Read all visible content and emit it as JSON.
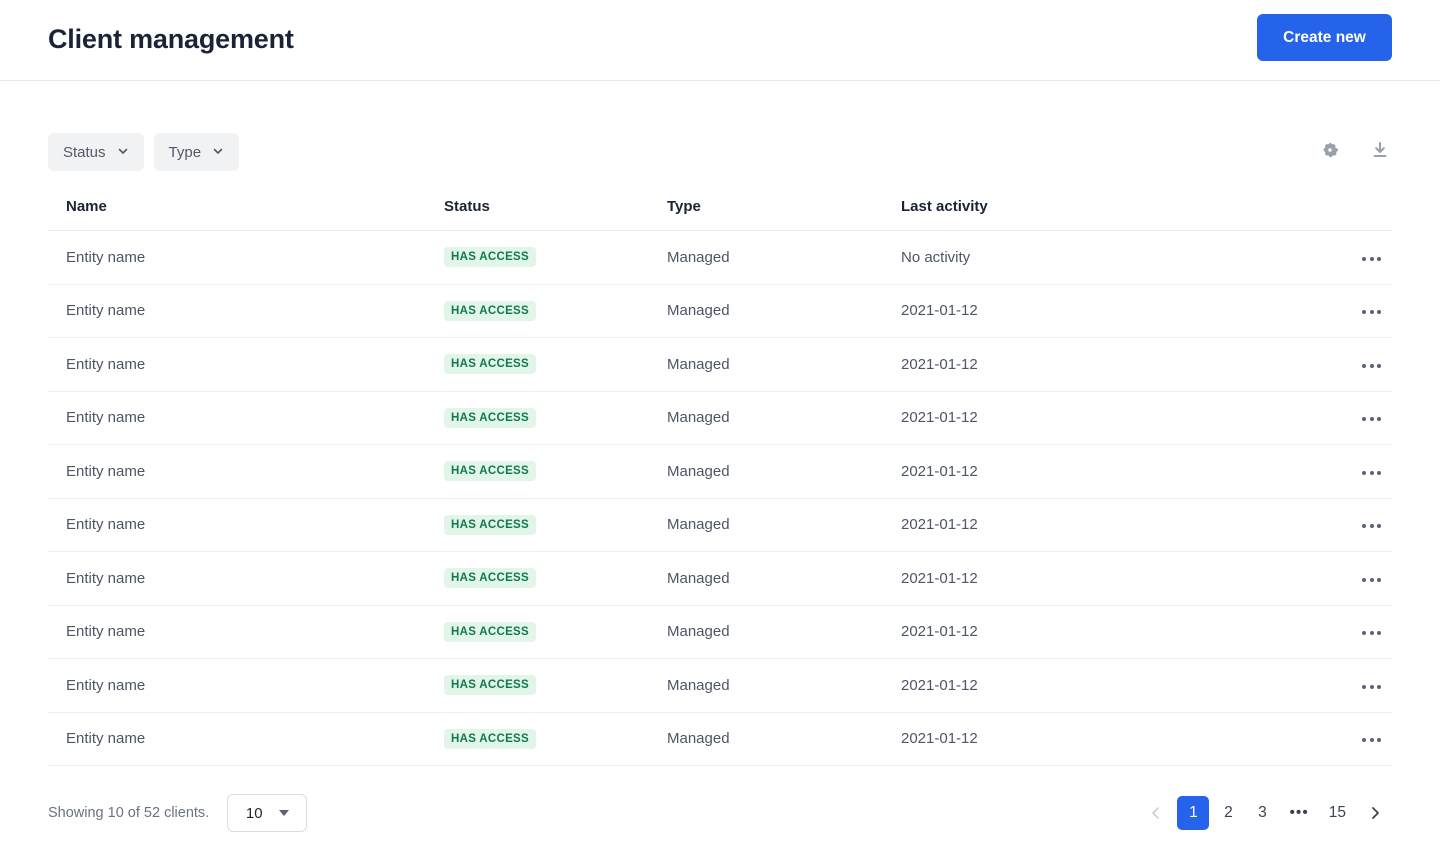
{
  "header": {
    "title": "Client management",
    "create_label": "Create new"
  },
  "toolbar": {
    "filters": [
      {
        "label": "Status",
        "icon": "chevron-down-icon"
      },
      {
        "label": "Type",
        "icon": "chevron-down-icon"
      }
    ],
    "icons": [
      {
        "name": "gear-icon",
        "title": "Settings"
      },
      {
        "name": "download-icon",
        "title": "Download"
      }
    ]
  },
  "table": {
    "columns": [
      "Name",
      "Status",
      "Type",
      "Last activity"
    ],
    "rows": [
      {
        "name": "Entity name",
        "status": "HAS ACCESS",
        "type": "Managed",
        "last_activity": "No activity",
        "actions": "•••"
      },
      {
        "name": "Entity name",
        "status": "HAS ACCESS",
        "type": "Managed",
        "last_activity": "2021-01-12",
        "actions": "•••"
      },
      {
        "name": "Entity name",
        "status": "HAS ACCESS",
        "type": "Managed",
        "last_activity": "2021-01-12",
        "actions": "•••"
      },
      {
        "name": "Entity name",
        "status": "HAS ACCESS",
        "type": "Managed",
        "last_activity": "2021-01-12",
        "actions": "•••"
      },
      {
        "name": "Entity name",
        "status": "HAS ACCESS",
        "type": "Managed",
        "last_activity": "2021-01-12",
        "actions": "•••"
      },
      {
        "name": "Entity name",
        "status": "HAS ACCESS",
        "type": "Managed",
        "last_activity": "2021-01-12",
        "actions": "•••"
      },
      {
        "name": "Entity name",
        "status": "HAS ACCESS",
        "type": "Managed",
        "last_activity": "2021-01-12",
        "actions": "•••"
      },
      {
        "name": "Entity name",
        "status": "HAS ACCESS",
        "type": "Managed",
        "last_activity": "2021-01-12",
        "actions": "•••"
      },
      {
        "name": "Entity name",
        "status": "HAS ACCESS",
        "type": "Managed",
        "last_activity": "2021-01-12",
        "actions": "•••"
      },
      {
        "name": "Entity name",
        "status": "HAS ACCESS",
        "type": "Managed",
        "last_activity": "2021-01-12",
        "actions": "•••"
      }
    ]
  },
  "footer": {
    "showing_text": "Showing 10 of 52 clients.",
    "page_size_value": "10",
    "pagination": {
      "prev": "‹",
      "next": "›",
      "pages": [
        "1",
        "2",
        "3",
        "•••",
        "15"
      ],
      "active_page": "1"
    }
  },
  "colors": {
    "accent": "#2563eb",
    "badge_bg": "#e1f5e9",
    "badge_text": "#12794f",
    "title": "#1b2437",
    "body_text": "#4d5566",
    "muted": "#6b7280",
    "border": "#e6e8eb",
    "pill_bg": "#f1f2f4"
  }
}
